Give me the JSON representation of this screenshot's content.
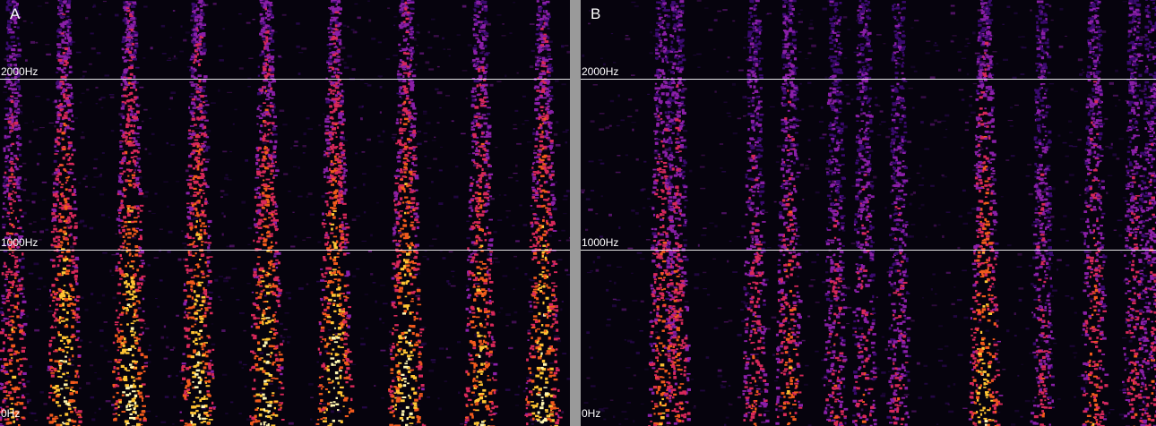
{
  "chart_data": [
    {
      "type": "heatmap",
      "panel_label": "A",
      "ylabel_ticks": [
        "0Hz",
        "1000Hz",
        "2000Hz"
      ],
      "ytick_values": [
        0,
        1000,
        2000
      ],
      "ylim": [
        0,
        2500
      ],
      "grid": true,
      "colormap": [
        "#06030d",
        "#3a0a6e",
        "#8a1fa8",
        "#d8285a",
        "#f25a1c",
        "#ffc533",
        "#fff7b0"
      ],
      "bursts": [
        {
          "t": 0.02,
          "energy": 0.7,
          "max_freq": 2500
        },
        {
          "t": 0.11,
          "energy": 0.95,
          "max_freq": 2500
        },
        {
          "t": 0.225,
          "energy": 1.0,
          "max_freq": 2500
        },
        {
          "t": 0.345,
          "energy": 0.95,
          "max_freq": 2500
        },
        {
          "t": 0.465,
          "energy": 0.95,
          "max_freq": 2500
        },
        {
          "t": 0.585,
          "energy": 1.0,
          "max_freq": 2500
        },
        {
          "t": 0.71,
          "energy": 1.0,
          "max_freq": 2500
        },
        {
          "t": 0.84,
          "energy": 0.85,
          "max_freq": 2500
        },
        {
          "t": 0.95,
          "energy": 0.95,
          "max_freq": 2500
        }
      ]
    },
    {
      "type": "heatmap",
      "panel_label": "B",
      "ylabel_ticks": [
        "0Hz",
        "1000Hz",
        "2000Hz"
      ],
      "ytick_values": [
        0,
        1000,
        2000
      ],
      "ylim": [
        0,
        2500
      ],
      "grid": true,
      "colormap": [
        "#06030d",
        "#3a0a6e",
        "#8a1fa8",
        "#d8285a",
        "#f25a1c",
        "#ffc533",
        "#fff7b0"
      ],
      "bursts": [
        {
          "t": 0.14,
          "energy": 0.7,
          "max_freq": 2500
        },
        {
          "t": 0.165,
          "energy": 0.6,
          "max_freq": 2500
        },
        {
          "t": 0.3,
          "energy": 0.55,
          "max_freq": 2500
        },
        {
          "t": 0.36,
          "energy": 0.65,
          "max_freq": 2500
        },
        {
          "t": 0.44,
          "energy": 0.45,
          "max_freq": 2500
        },
        {
          "t": 0.49,
          "energy": 0.5,
          "max_freq": 2500
        },
        {
          "t": 0.55,
          "energy": 0.45,
          "max_freq": 2500
        },
        {
          "t": 0.7,
          "energy": 0.85,
          "max_freq": 2500
        },
        {
          "t": 0.8,
          "energy": 0.45,
          "max_freq": 2500
        },
        {
          "t": 0.89,
          "energy": 0.6,
          "max_freq": 2500
        },
        {
          "t": 0.96,
          "energy": 0.5,
          "max_freq": 2500
        },
        {
          "t": 0.99,
          "energy": 0.45,
          "max_freq": 2500
        }
      ]
    }
  ]
}
